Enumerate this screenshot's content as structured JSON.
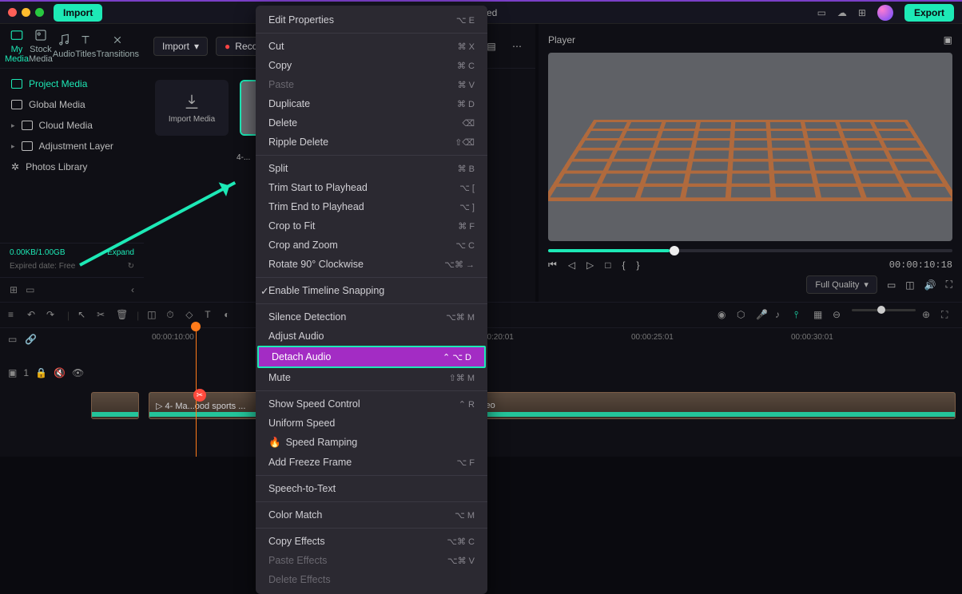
{
  "titlebar": {
    "import_btn": "Import",
    "title": "Untitled",
    "export_btn": "Export"
  },
  "tabs": [
    {
      "label": "My Media",
      "icon": "media"
    },
    {
      "label": "Stock Media",
      "icon": "stock"
    },
    {
      "label": "Audio",
      "icon": "audio"
    },
    {
      "label": "Titles",
      "icon": "titles"
    },
    {
      "label": "Transitions",
      "icon": "transitions"
    }
  ],
  "tree": [
    {
      "label": "Project Media",
      "active": true
    },
    {
      "label": "Global Media"
    },
    {
      "label": "Cloud Media"
    },
    {
      "label": "Adjustment Layer"
    },
    {
      "label": "Photos Library"
    }
  ],
  "storage": {
    "used": "0.00KB/1.00GB",
    "expand": "Expand",
    "expired": "Expired date: Free",
    "refresh": "↻"
  },
  "midbar": {
    "import": "Import",
    "record": "Record"
  },
  "thumbcards": {
    "import_media": "Import Media",
    "sel_label": "4-..."
  },
  "ctx": [
    {
      "t": "Edit Properties",
      "sc": "⌥ E"
    },
    "hr",
    {
      "t": "Cut",
      "sc": "⌘ X"
    },
    {
      "t": "Copy",
      "sc": "⌘ C"
    },
    {
      "t": "Paste",
      "sc": "⌘ V",
      "dis": true
    },
    {
      "t": "Duplicate",
      "sc": "⌘ D"
    },
    {
      "t": "Delete",
      "sc": "⌫"
    },
    {
      "t": "Ripple Delete",
      "sc": "⇧⌫"
    },
    "hr",
    {
      "t": "Split",
      "sc": "⌘ B"
    },
    {
      "t": "Trim Start to Playhead",
      "sc": "⌥ ["
    },
    {
      "t": "Trim End to Playhead",
      "sc": "⌥ ]"
    },
    {
      "t": "Crop to Fit",
      "sc": "⌘ F"
    },
    {
      "t": "Crop and Zoom",
      "sc": "⌥ C"
    },
    {
      "t": "Rotate 90° Clockwise",
      "sc": "⌥⌘ →"
    },
    "hr",
    {
      "t": "Enable Timeline Snapping",
      "check": true
    },
    "hr",
    {
      "t": "Silence Detection",
      "sc": "⌥⌘ M"
    },
    {
      "t": "Adjust Audio"
    },
    {
      "t": "Detach Audio",
      "sc": "⌃ ⌥ D",
      "hl": true
    },
    {
      "t": "Mute",
      "sc": "⇧⌘ M"
    },
    "hr",
    {
      "t": "Show Speed Control",
      "sc": "⌃ R"
    },
    {
      "t": "Uniform Speed"
    },
    {
      "t": "Speed Ramping",
      "flame": true
    },
    {
      "t": "Add Freeze Frame",
      "sc": "⌥ F"
    },
    "hr",
    {
      "t": "Speech-to-Text"
    },
    "hr",
    {
      "t": "Color Match",
      "sc": "⌥ M"
    },
    "hr",
    {
      "t": "Copy Effects",
      "sc": "⌥⌘ C"
    },
    {
      "t": "Paste Effects",
      "sc": "⌥⌘ V",
      "dis": true
    },
    {
      "t": "Delete Effects",
      "dis": true
    }
  ],
  "player": {
    "label": "Player",
    "timecode": "00:00:10:18",
    "quality": "Full Quality",
    "brackets_open": "{",
    "brackets_close": "}"
  },
  "ruler": [
    "00:00:10:00",
    "00:00:20:01",
    "00:00:25:01",
    "00:00:30:01"
  ],
  "trackhead": {
    "eye": "👁",
    "count": "1"
  },
  "clips": {
    "a": "4- Ma...ood sports ...",
    "b": "sports courts video"
  }
}
